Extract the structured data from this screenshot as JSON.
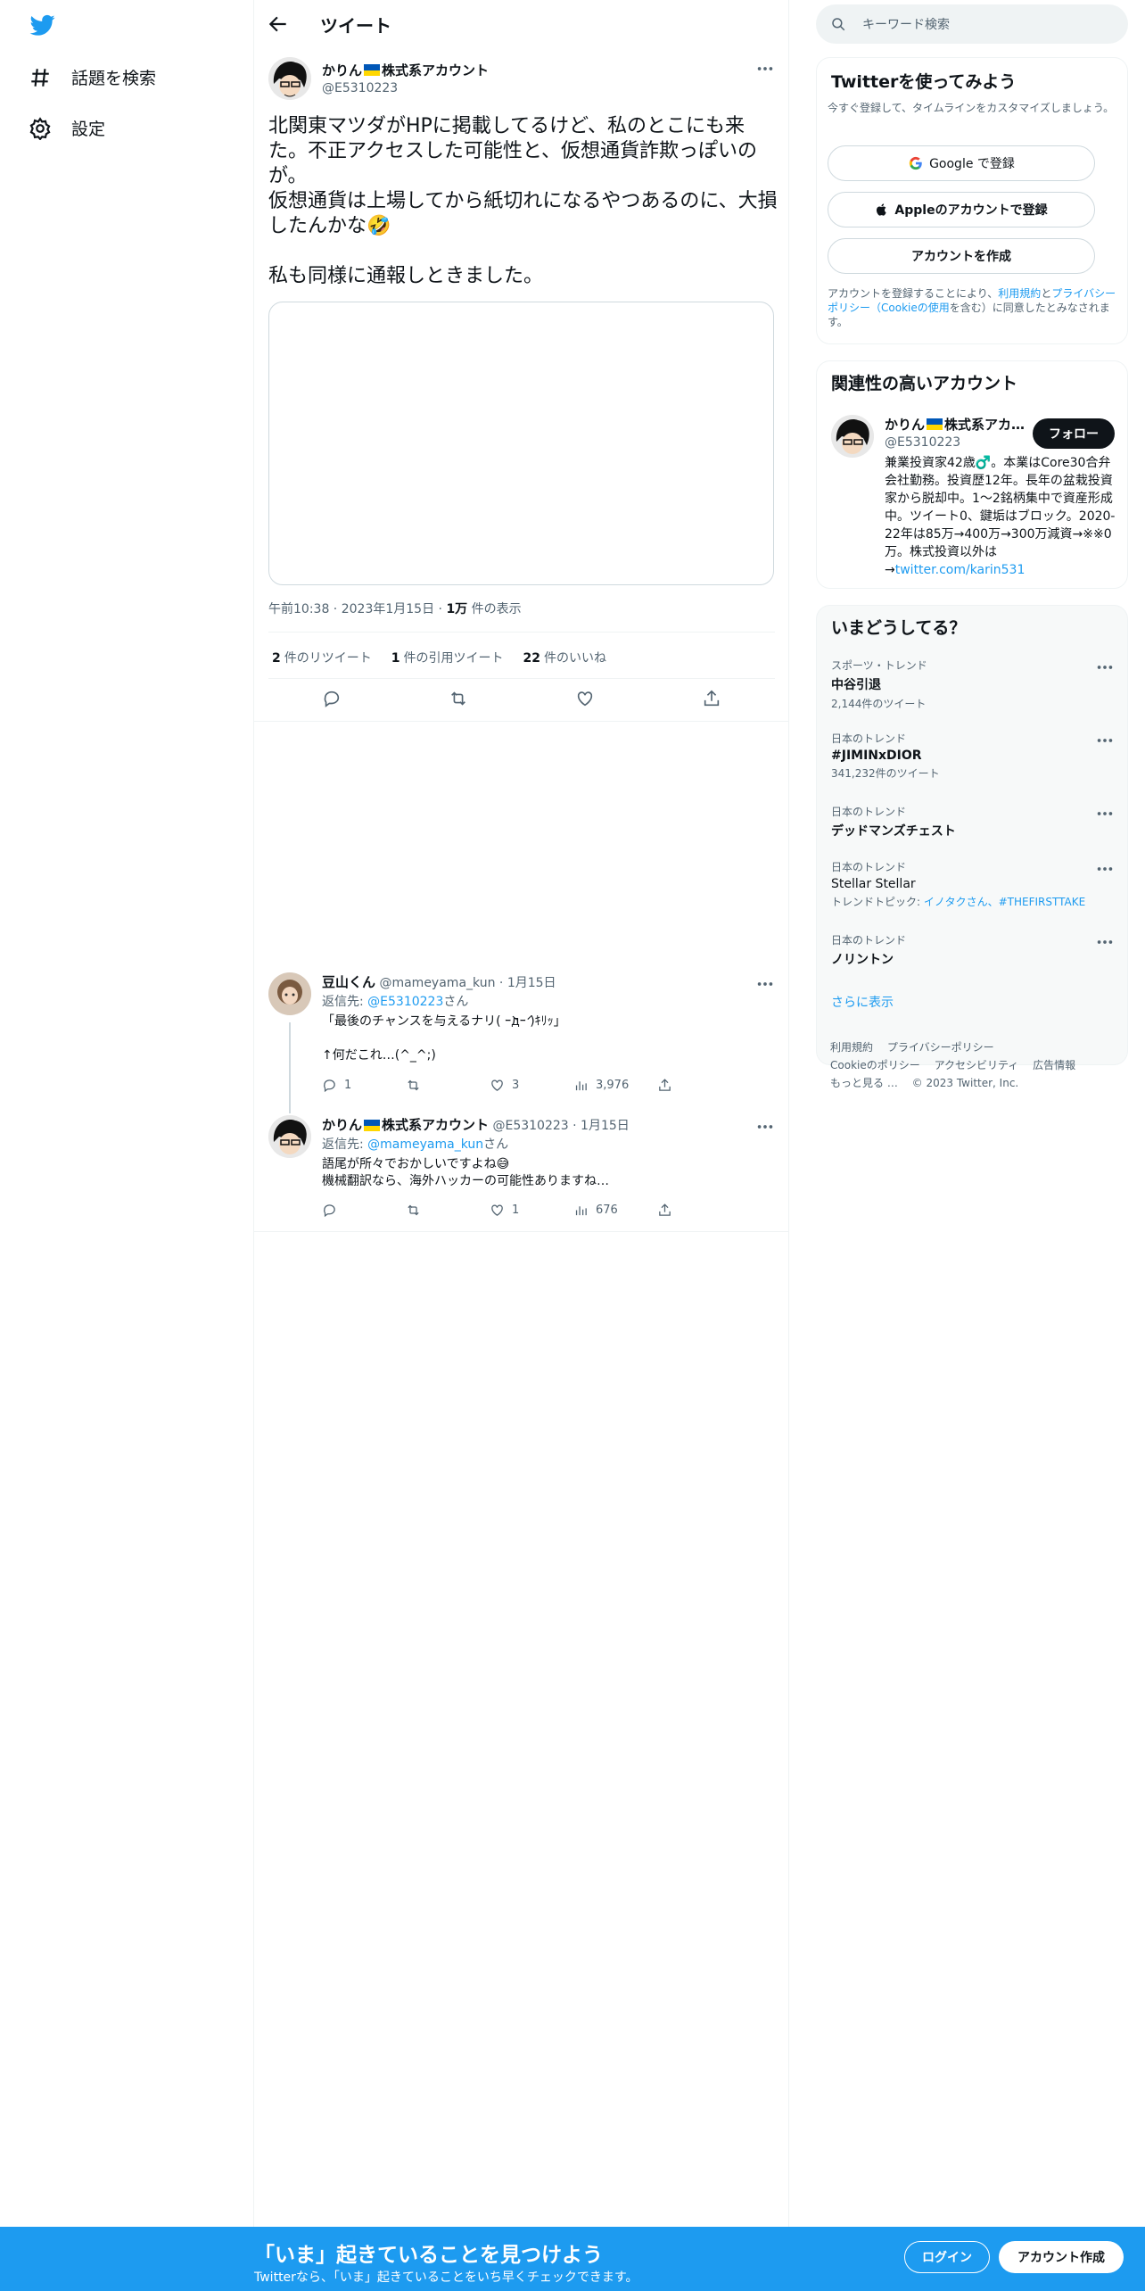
{
  "nav": {
    "explore_label": "話題を検索",
    "settings_label": "設定"
  },
  "header": {
    "title": "ツイート"
  },
  "tweet": {
    "author_name": "かりん",
    "author_suffix": "株式系アカウント",
    "author_handle": "@E5310223",
    "text": "北関東マツダがHPに掲載してるけど、私のとこにも来た。不正アクセスした可能性と、仮想通貨詐欺っぽいのが。\n仮想通貨は上場してから紙切れになるやつあるのに、大損したんかな🤣\n\n私も同様に通報しときました。",
    "time": "午前10:38",
    "date": "2023年1月15日",
    "views_count": "1万",
    "views_label": "件の表示",
    "retweets_count": "2",
    "retweets_label": "件のリツイート",
    "quotes_count": "1",
    "quotes_label": "件の引用ツイート",
    "likes_count": "22",
    "likes_label": "件のいいね"
  },
  "replies": [
    {
      "name": "豆山くん",
      "handle": "@mameyama_kun",
      "date": "1月15日",
      "replying_prefix": "返信先: ",
      "replying_to": "@E5310223",
      "replying_suffix": "さん",
      "text": "「最後のチャンスを与えるナリ( ｰ̀дｰ́ )ｷﾘｯ」\n\n↑何だこれ…(^_^;)",
      "reply_count": "1",
      "retweet_count": "",
      "like_count": "3",
      "view_count": "3,976"
    },
    {
      "name": "かりん",
      "name_suffix": "株式系アカウント",
      "handle": "@E5310223",
      "date": "1月15日",
      "replying_prefix": "返信先: ",
      "replying_to": "@mameyama_kun",
      "replying_suffix": "さん",
      "text": "語尾が所々でおかしいですよね😅\n機械翻訳なら、海外ハッカーの可能性ありますね…",
      "reply_count": "",
      "retweet_count": "",
      "like_count": "1",
      "view_count": "676"
    }
  ],
  "search": {
    "placeholder": "キーワード検索"
  },
  "signup_card": {
    "title": "Twitterを使ってみよう",
    "subtitle": "今すぐ登録して、タイムラインをカスタマイズしましょう。",
    "google_label": "Google で登録",
    "apple_label": "Appleのアカウントで登録",
    "create_label": "アカウントを作成",
    "terms_prefix": "アカウントを登録することにより、",
    "terms_link": "利用規約",
    "terms_and": "と",
    "privacy_link": "プライバシーポリシー（Cookieの使用",
    "terms_suffix": "を含む）に同意したとみなされます。"
  },
  "related": {
    "title": "関連性の高いアカウント",
    "name": "かりん",
    "name_suffix": "株式系アカ…",
    "handle": "@E5310223",
    "follow_label": "フォロー",
    "bio": "兼業投資家42歳♂️。本業はCore30合弁会社勤務。投資歴12年。長年の盆栽投資家から脱却中。1～2銘柄集中で資産形成中。ツイート0、鍵垢はブロック。2020-22年は85万→400万→300万減資→※※0万。株式投資以外は→",
    "link": "twitter.com/karin531"
  },
  "trends": {
    "title": "いまどうしてる？",
    "items": [
      {
        "category": "スポーツ・トレンド",
        "title": "中谷引退",
        "count": "2,144件のツイート"
      },
      {
        "category": "日本のトレンド",
        "title": "#JIMINxDIOR",
        "count": "341,232件のツイート"
      },
      {
        "category": "日本のトレンド",
        "title": "デッドマンズチェスト",
        "count": ""
      },
      {
        "category": "日本のトレンド",
        "title": "Stellar Stellar",
        "topics_prefix": "トレンドトピック: ",
        "topics": "イノタクさん、#THEFIRSTTAKE"
      },
      {
        "category": "日本のトレンド",
        "title": "ノリントン",
        "count": ""
      }
    ],
    "show_more": "さらに表示"
  },
  "footer": {
    "links": [
      "利用規約",
      "プライバシーポリシー",
      "Cookieのポリシー",
      "アクセシビリティ",
      "広告情報",
      "もっと見る …"
    ],
    "copyright": "© 2023 Twitter, Inc."
  },
  "bottom_bar": {
    "title": "「いま」起きていることを見つけよう",
    "subtitle": "Twitterなら、「いま」起きていることをいち早くチェックできます。",
    "login_label": "ログイン",
    "signup_label": "アカウント作成"
  },
  "colors": {
    "accent": "#1d9bf0",
    "text": "#0f1419",
    "muted": "#536471"
  }
}
